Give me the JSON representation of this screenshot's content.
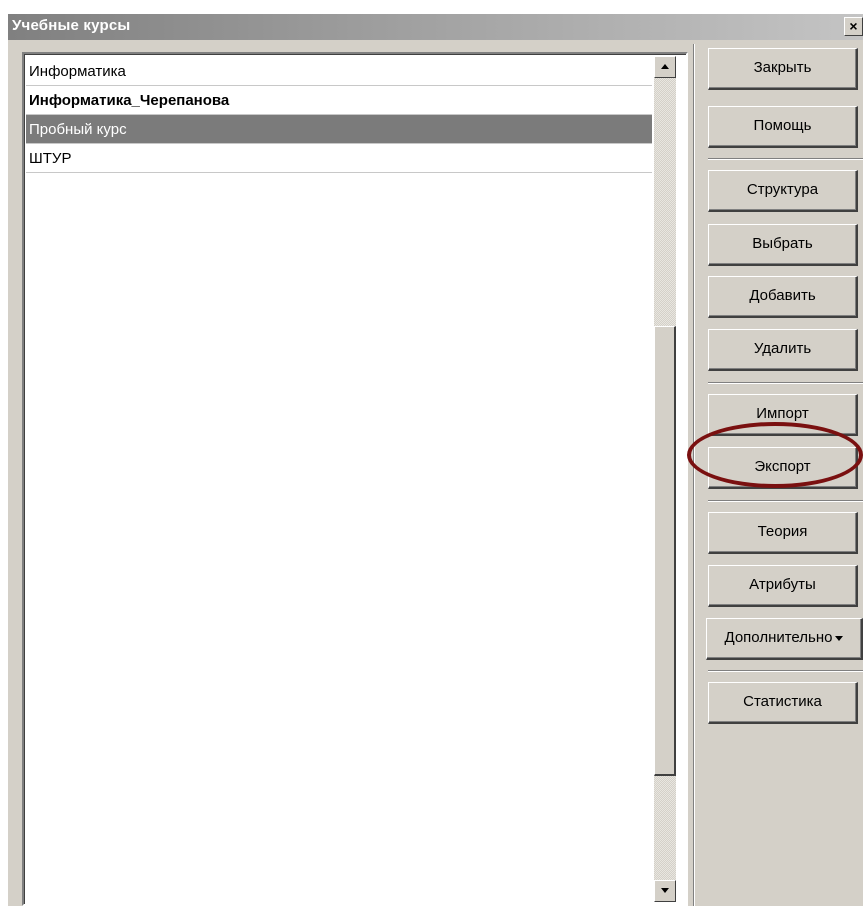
{
  "window": {
    "title": "Учебные курсы",
    "close_glyph": "×"
  },
  "courses": [
    {
      "label": "Информатика",
      "bold": false,
      "selected": false
    },
    {
      "label": "Информатика_Черепанова",
      "bold": true,
      "selected": false
    },
    {
      "label": "Пробный курс",
      "bold": false,
      "selected": true
    },
    {
      "label": "ШТУР",
      "bold": false,
      "selected": false
    }
  ],
  "scrollbar": {
    "up_icon": "arrow-up-icon",
    "down_icon": "arrow-down-icon"
  },
  "buttons": {
    "close": "Закрыть",
    "help": "Помощь",
    "structure": "Структура",
    "select": "Выбрать",
    "add": "Добавить",
    "delete": "Удалить",
    "import": "Импорт",
    "export": "Экспорт",
    "theory": "Теория",
    "attributes": "Атрибуты",
    "more": "Дополнительно",
    "statistics": "Статистика"
  },
  "colors": {
    "selection": "#7b7b7b",
    "highlight": "#7a1010"
  }
}
